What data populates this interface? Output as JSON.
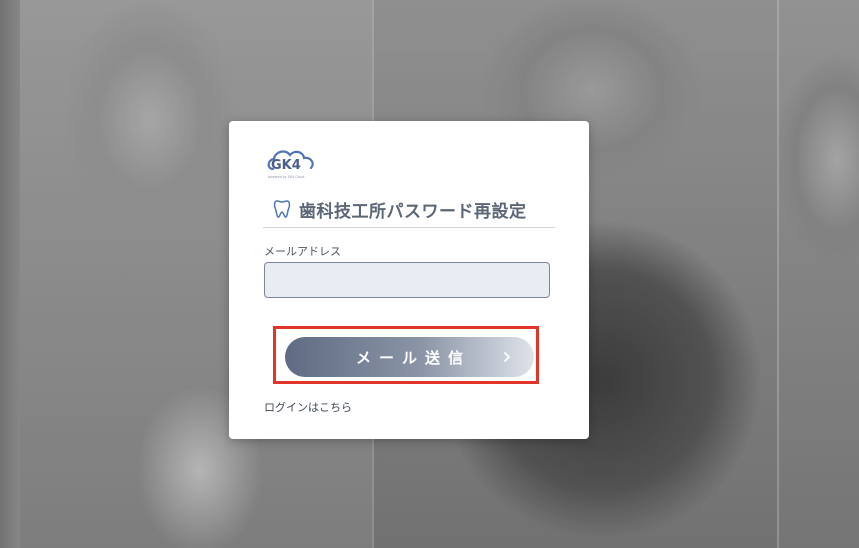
{
  "card": {
    "logo_text": "GK4",
    "logo_tagline": "powered by GK4 Cloud",
    "title": "歯科技工所パスワード再設定",
    "email_label": "メールアドレス",
    "email_value": "",
    "email_placeholder": "",
    "send_button_label": "メール送信",
    "login_link": "ログインはこちら"
  },
  "icons": {
    "logo": "cloud-logo-icon",
    "title": "tooth-icon",
    "button": "chevron-right-icon"
  },
  "colors": {
    "accent": "#5c6677",
    "button_start": "#5e6b82",
    "button_end": "#dfe3ea",
    "input_bg": "#e8ecf3",
    "highlight": "#e2352a"
  }
}
